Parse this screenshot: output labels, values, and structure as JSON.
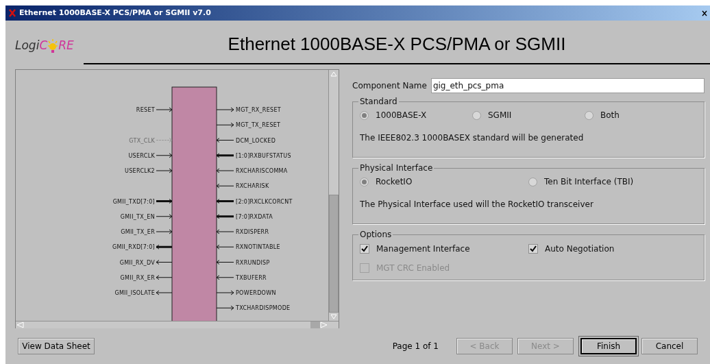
{
  "window": {
    "title": "Ethernet 1000BASE-X PCS/PMA or SGMII v7.0"
  },
  "logo": {
    "lead": "Logi",
    "mid": "C",
    "tail": "RE"
  },
  "heading": "Ethernet 1000BASE-X PCS/PMA or SGMII",
  "diagram": {
    "left_pin_groups": [
      [
        {
          "label": "RESET",
          "inward": true,
          "bus": false,
          "disabled": false
        }
      ],
      [
        {
          "label": "GTX_CLK",
          "inward": true,
          "bus": false,
          "disabled": true
        },
        {
          "label": "USERCLK",
          "inward": true,
          "bus": false,
          "disabled": false
        },
        {
          "label": "USERCLK2",
          "inward": true,
          "bus": false,
          "disabled": false
        }
      ],
      [
        {
          "label": "GMII_TXD[7:0]",
          "inward": true,
          "bus": true,
          "disabled": false
        },
        {
          "label": "GMII_TX_EN",
          "inward": true,
          "bus": false,
          "disabled": false
        },
        {
          "label": "GMII_TX_ER",
          "inward": true,
          "bus": false,
          "disabled": false
        },
        {
          "label": "GMII_RXD[7:0]",
          "inward": false,
          "bus": true,
          "disabled": false
        },
        {
          "label": "GMII_RX_DV",
          "inward": false,
          "bus": false,
          "disabled": false
        },
        {
          "label": "GMII_RX_ER",
          "inward": false,
          "bus": false,
          "disabled": false
        },
        {
          "label": "GMII_ISOLATE",
          "inward": false,
          "bus": false,
          "disabled": false
        }
      ]
    ],
    "right_pins": [
      {
        "label": "MGT_RX_RESET",
        "inward": false,
        "bus": false,
        "disabled": false
      },
      {
        "label": "MGT_TX_RESET",
        "inward": false,
        "bus": false,
        "disabled": false
      },
      {
        "label": "DCM_LOCKED",
        "inward": true,
        "bus": false,
        "disabled": false
      },
      {
        "label": "[1:0]RXBUFSTATUS",
        "inward": true,
        "bus": true,
        "disabled": false
      },
      {
        "label": "RXCHARISCOMMA",
        "inward": true,
        "bus": false,
        "disabled": false
      },
      {
        "label": "RXCHARISK",
        "inward": true,
        "bus": false,
        "disabled": false
      },
      {
        "label": "[2:0]RXCLKCORCNT",
        "inward": true,
        "bus": true,
        "disabled": false
      },
      {
        "label": "[7:0]RXDATA",
        "inward": true,
        "bus": true,
        "disabled": false
      },
      {
        "label": "RXDISPERR",
        "inward": true,
        "bus": false,
        "disabled": false
      },
      {
        "label": "RXNOTINTABLE",
        "inward": true,
        "bus": false,
        "disabled": false
      },
      {
        "label": "RXRUNDISP",
        "inward": true,
        "bus": false,
        "disabled": false
      },
      {
        "label": "TXBUFERR",
        "inward": true,
        "bus": false,
        "disabled": false
      },
      {
        "label": "POWERDOWN",
        "inward": false,
        "bus": false,
        "disabled": false
      },
      {
        "label": "TXCHARDISPMODE",
        "inward": false,
        "bus": false,
        "disabled": false
      }
    ]
  },
  "component_name": {
    "label": "Component Name",
    "value": "gig_eth_pcs_pma"
  },
  "groups": [
    {
      "title": "Standard",
      "radios": [
        {
          "label": "1000BASE-X",
          "selected": true
        },
        {
          "label": "SGMII",
          "selected": false
        },
        {
          "label": "Both",
          "selected": false
        }
      ],
      "note": "The IEEE802.3 1000BASEX standard will be generated"
    },
    {
      "title": "Physical Interface",
      "radios": [
        {
          "label": "RocketIO",
          "selected": true
        },
        {
          "label": "Ten Bit Interface (TBI)",
          "selected": false
        }
      ],
      "note": "The Physical Interface used will the RocketIO transceiver"
    },
    {
      "title": "Options",
      "checks": [
        {
          "label": "Management Interface",
          "checked": true,
          "disabled": false
        },
        {
          "label": "Auto Negotiation",
          "checked": true,
          "disabled": false
        },
        {
          "label": "MGT CRC Enabled",
          "checked": false,
          "disabled": true
        }
      ]
    }
  ],
  "footer": {
    "datasheet": {
      "label": "View Data Sheet",
      "disabled": false,
      "default": false
    },
    "page": "Page 1 of 1",
    "buttons": [
      {
        "label": "< Back",
        "disabled": true,
        "default": false
      },
      {
        "label": "Next >",
        "disabled": true,
        "default": false
      },
      {
        "label": "Finish",
        "disabled": false,
        "default": true
      },
      {
        "label": "Cancel",
        "disabled": false,
        "default": false
      }
    ]
  }
}
